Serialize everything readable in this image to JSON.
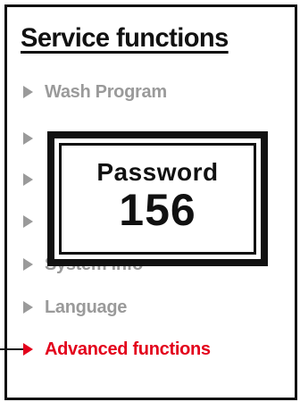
{
  "screen": {
    "title": "Service functions"
  },
  "menu": {
    "items": [
      {
        "label": "Wash Program",
        "active": false
      },
      {
        "label": "",
        "active": false
      },
      {
        "label": "",
        "active": false
      },
      {
        "label": "",
        "active": false
      },
      {
        "label": "System info",
        "active": false
      },
      {
        "label": "Language",
        "active": false
      },
      {
        "label": "Advanced functions",
        "active": true
      }
    ]
  },
  "password_dialog": {
    "title": "Password",
    "value": "156"
  },
  "colors": {
    "inactive_text": "#9a9a9a",
    "active_text": "#e3001b",
    "frame": "#111111"
  },
  "icons": {
    "menu_arrow": "triangle-right-icon"
  }
}
